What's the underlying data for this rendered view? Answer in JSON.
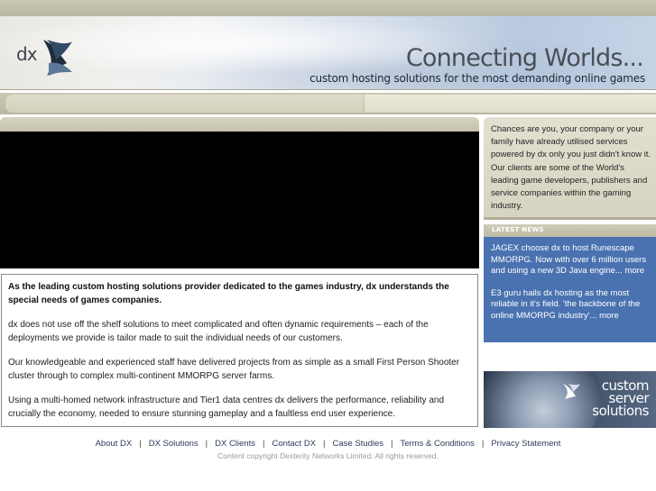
{
  "header": {
    "logo_text": "dx",
    "tagline": "Connecting Worlds...",
    "subtagline": "custom hosting solutions for the most demanding online games"
  },
  "content": {
    "lead": "As the leading custom hosting solutions provider dedicated to the games industry, dx understands the special needs of games companies.",
    "paragraphs": [
      "dx does not use off the shelf solutions to meet complicated and often dynamic requirements – each of the deployments we provide is tailor made to suit the individual needs of our customers.",
      "Our knowledgeable and experienced staff have delivered projects from as simple as a small First Person Shooter cluster through to complex multi-continent MMORPG server farms.",
      "Using a multi-homed network infrastructure and Tier1 data centres dx delivers the performance, reliability and crucially the economy, needed to ensure stunning gameplay and a faultless end user experience."
    ]
  },
  "sidebar": {
    "intro": "Chances are you, your company or your family have already utilised services powered by dx only you just didn't know it. Our clients are some of the World's leading game developers, publishers and service companies within the gaming industry.",
    "news_heading": "LATEST NEWS",
    "news": [
      {
        "text": "JAGEX choose dx to host Runescape MMORPG. Now with over 6 million users and using a new 3D Java engine...",
        "more": "more"
      },
      {
        "text": "E3 guru hails dx hosting as the most reliable in it's field. 'the backbone of the online MMORPG industry'...",
        "more": "more"
      }
    ],
    "promo_lines": [
      "custom",
      "server",
      "solutions"
    ]
  },
  "footer": {
    "links": [
      "About DX",
      "DX Solutions",
      "DX Clients",
      "Contact DX",
      "Case Studies",
      "Terms & Conditions",
      "Privacy Statement"
    ],
    "separator": "|",
    "copyright": "Content copyright Dexterity Networks Limited. All rights reserved."
  },
  "colors": {
    "news_bg": "#4a72b0",
    "header_bar": "#c4c1ac"
  }
}
